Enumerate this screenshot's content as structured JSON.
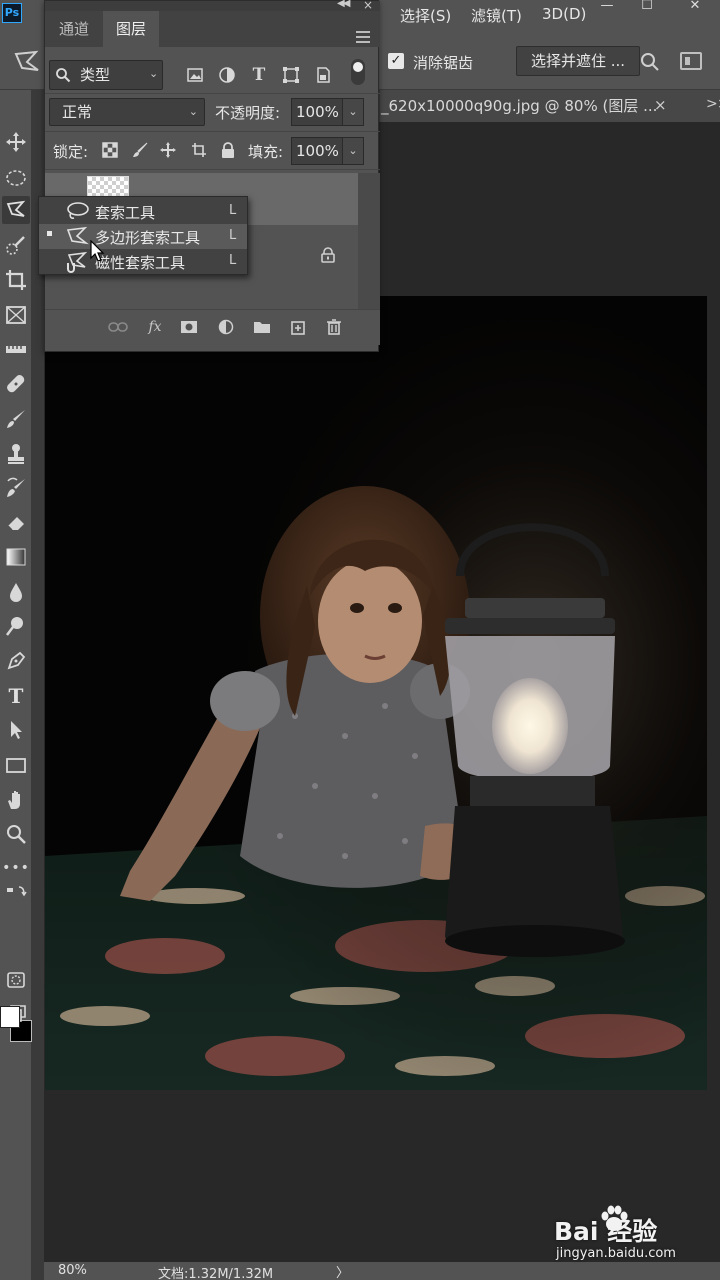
{
  "menubar": {
    "app_logo": "Ps",
    "items": [
      {
        "label": "选择(S)"
      },
      {
        "label": "滤镜(T)"
      },
      {
        "label": "3D(D)"
      }
    ]
  },
  "options_bar": {
    "antialias_checked": true,
    "antialias_label": "消除锯齿",
    "select_mask_label": "选择并遮住 ..."
  },
  "document": {
    "tab_title": "_620x10000q90g.jpg @ 80% (图层 ...",
    "close_glyph": "×",
    "scroll_glyph": ">>"
  },
  "layers_panel": {
    "tabs": [
      {
        "label": "通道",
        "active": false
      },
      {
        "label": "图层",
        "active": true
      }
    ],
    "filter_kind": "类型",
    "blend_mode": "正常",
    "opacity_label": "不透明度:",
    "opacity_value": "100%",
    "lock_label": "锁定:",
    "fill_label": "填充:",
    "fill_value": "100%",
    "layers": [
      {
        "name": "",
        "selected": true
      },
      {
        "name": "",
        "locked": true,
        "selected": false
      }
    ],
    "footer_fx": "fx"
  },
  "lasso_flyout": {
    "items": [
      {
        "label": "套索工具",
        "shortcut": "L",
        "icon": "lasso-icon",
        "active": false
      },
      {
        "label": "多边形套索工具",
        "shortcut": "L",
        "icon": "polygonal-lasso-icon",
        "active": true
      },
      {
        "label": "磁性套索工具",
        "shortcut": "L",
        "icon": "magnetic-lasso-icon",
        "active": false
      }
    ]
  },
  "toolbar": {
    "tools": [
      "move-tool",
      "marquee-tool",
      "polygonal-lasso-tool",
      "quick-selection-tool",
      "crop-tool",
      "frame-tool",
      "ruler-tool",
      "healing-brush-tool",
      "brush-tool",
      "clone-stamp-tool",
      "history-brush-tool",
      "eraser-tool",
      "gradient-tool",
      "blur-tool",
      "dodge-tool",
      "pen-tool",
      "type-tool",
      "path-selection-tool",
      "rectangle-tool",
      "hand-tool",
      "zoom-tool",
      "more-tools",
      "quick-mask",
      "screen-mode"
    ],
    "type_glyph": "T",
    "more_glyph": "•••",
    "foreground_color": "#ffffff",
    "background_color": "#000000"
  },
  "status": {
    "zoom": "80%",
    "doc_size": "文档:1.32M/1.32M",
    "arrow": "〉"
  },
  "watermark": {
    "brand": "Bai 经验",
    "url": "jingyan.baidu.com"
  }
}
